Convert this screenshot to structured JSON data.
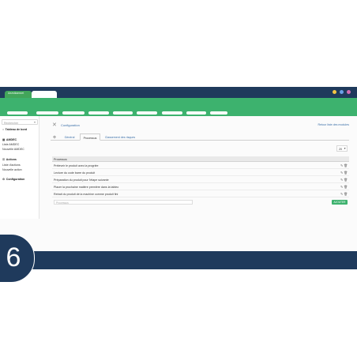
{
  "window": {
    "tab_label": "Aezstkamnet",
    "accent_color": "#3db26e",
    "chrome_color": "#1f3a5c"
  },
  "sidebar": {
    "search_placeholder": "Rechercher",
    "items": [
      {
        "label": "Tableau de bord",
        "icon": "home-icon",
        "type": "head"
      },
      {
        "label": "AMDEC",
        "icon": "grid-icon",
        "type": "head"
      },
      {
        "label": "Liste AMDEC",
        "type": "link"
      },
      {
        "label": "Nouvelle AMDEC",
        "type": "link"
      },
      {
        "label": "Actions",
        "icon": "list-icon",
        "type": "head"
      },
      {
        "label": "Liste d'actions",
        "type": "link"
      },
      {
        "label": "Nouvelle action",
        "type": "link"
      },
      {
        "label": "Configuration",
        "icon": "gear-icon",
        "type": "head"
      }
    ]
  },
  "header": {
    "title": "Configuration",
    "back_link": "Retour liste des modules"
  },
  "tabs": [
    {
      "label": "Général"
    },
    {
      "label": "Processus",
      "active": true
    },
    {
      "label": "Classement des risques"
    }
  ],
  "per_page": "20",
  "table": {
    "header": "Processus",
    "rows": [
      "Préleveir le produit avec la progrièe",
      "Lecture du code barre du produit",
      "Préparation du produit pour l'étape suivante",
      "Placer la prochaine matière première dans la tableo",
      "Retrait du produit de la machine comme produit fini"
    ]
  },
  "new_row": {
    "placeholder": "Processus",
    "save_label": "AJOUTER"
  },
  "badge_number": "6"
}
